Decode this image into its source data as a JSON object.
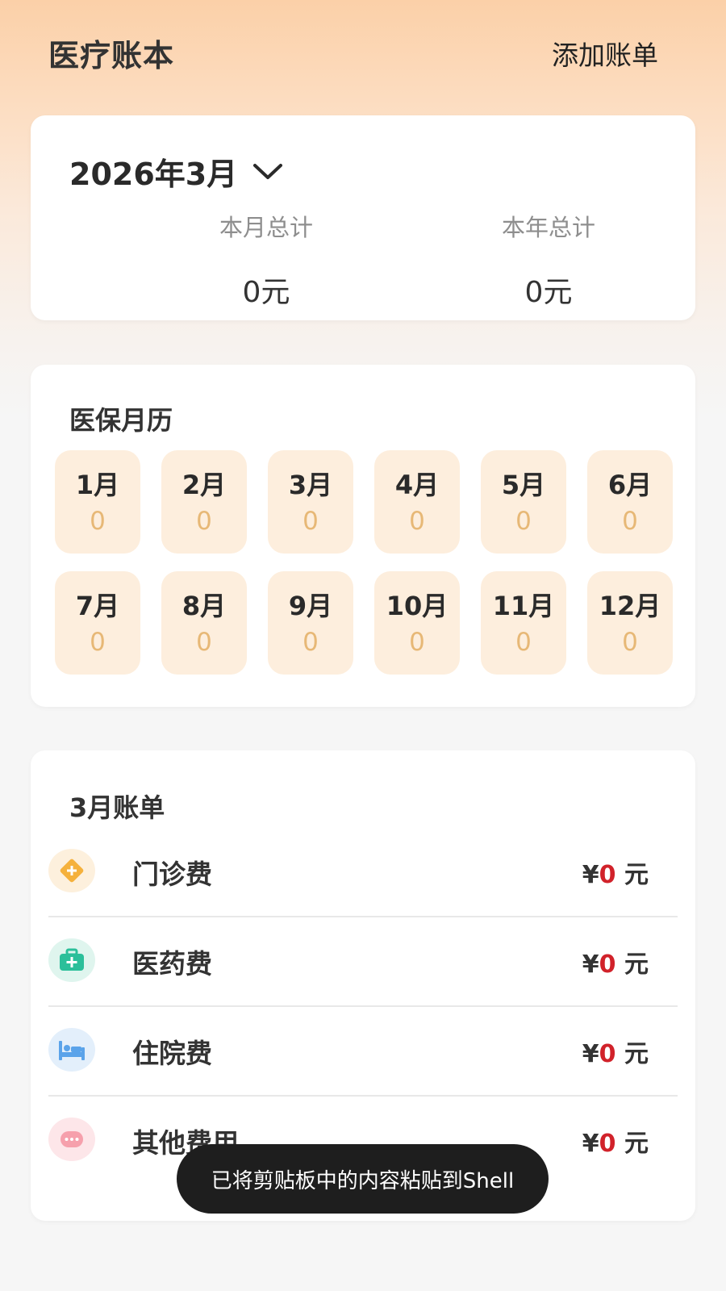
{
  "header": {
    "title": "医疗账本",
    "add_bill_label": "添加账单"
  },
  "summary": {
    "selected_month": "2026年3月",
    "month_total_label": "本月总计",
    "month_total_value": "0元",
    "year_total_label": "本年总计",
    "year_total_value": "0元"
  },
  "calendar": {
    "title": "医保月历",
    "months": [
      {
        "label": "1月",
        "value": "0"
      },
      {
        "label": "2月",
        "value": "0"
      },
      {
        "label": "3月",
        "value": "0"
      },
      {
        "label": "4月",
        "value": "0"
      },
      {
        "label": "5月",
        "value": "0"
      },
      {
        "label": "6月",
        "value": "0"
      },
      {
        "label": "7月",
        "value": "0"
      },
      {
        "label": "8月",
        "value": "0"
      },
      {
        "label": "9月",
        "value": "0"
      },
      {
        "label": "10月",
        "value": "0"
      },
      {
        "label": "11月",
        "value": "0"
      },
      {
        "label": "12月",
        "value": "0"
      }
    ]
  },
  "bills": {
    "title": "3月账单",
    "currency_symbol": "¥",
    "unit": "元",
    "items": [
      {
        "name": "门诊费",
        "amount": "0",
        "icon": "outpatient-icon",
        "color": "#f5b13c",
        "bg": "#fdf0dd"
      },
      {
        "name": "医药费",
        "amount": "0",
        "icon": "medicine-kit-icon",
        "color": "#2bbf9a",
        "bg": "#dff5ee"
      },
      {
        "name": "住院费",
        "amount": "0",
        "icon": "hospital-bed-icon",
        "color": "#5aa3ea",
        "bg": "#e3effb"
      },
      {
        "name": "其他费用",
        "amount": "0",
        "icon": "more-dots-icon",
        "color": "#f6a0ac",
        "bg": "#fde6e9"
      }
    ]
  },
  "toast": {
    "message": "已将剪贴板中的内容粘贴到Shell"
  },
  "colors": {
    "accent_red": "#d1222a",
    "calendar_cell_bg": "#fdeedd",
    "calendar_value": "#e7b876"
  }
}
